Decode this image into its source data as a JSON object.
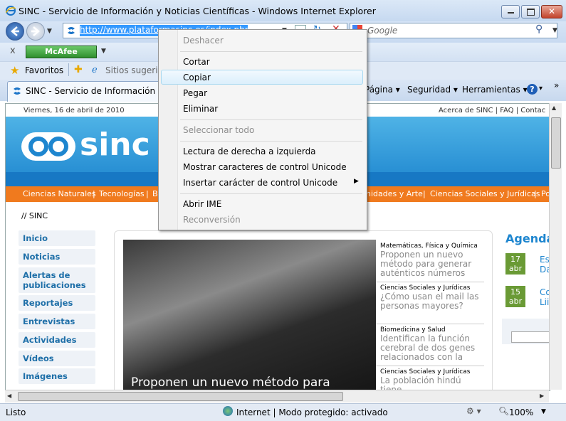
{
  "window": {
    "title": "SINC - Servicio de Información y Noticias Científicas - Windows Internet Explorer"
  },
  "address_bar": {
    "url": "http://www.plataformasinc.es/index.php/es"
  },
  "search": {
    "placeholder": "Google"
  },
  "toolbar": {
    "close_x": "x",
    "mcafee": "McAfee"
  },
  "favorites_bar": {
    "favorites_label": "Favoritos",
    "suggested_sites": "Sitios sugerido"
  },
  "tab": {
    "label": "SINC - Servicio de Información y No"
  },
  "command_bar": {
    "page": "Página",
    "security": "Seguridad",
    "tools": "Herramientas",
    "help": "?"
  },
  "page": {
    "date": "Viernes, 16 de abril de 2010",
    "top_links": [
      "Acerca de SINC",
      "FAQ",
      "Contac"
    ],
    "logo_text": "sinc",
    "menu": [
      "Ciencias Naturales",
      "Tecnologías",
      "B",
      "nidades y Arte",
      "Ciencias Sociales y Jurídicas",
      "Po"
    ],
    "breadcrumb": "// SINC",
    "sidebar": [
      "Inicio",
      "Noticias",
      "Alertas de publicaciones",
      "Reportajes",
      "Entrevistas",
      "Actividades",
      "Vídeos",
      "Imágenes"
    ],
    "feature_caption": "Proponen un nuevo método para",
    "news": [
      {
        "category": "Matemáticas, Física y Química",
        "title": "Proponen un nuevo método para generar auténticos números"
      },
      {
        "category": "Ciencias Sociales y Jurídicas",
        "title": "¿Cómo usan el mail las personas mayores?"
      },
      {
        "category": "Biomedicina y Salud",
        "title": "Identifican la función cerebral de dos genes relacionados con la"
      },
      {
        "category": "Ciencias Sociales y Jurídicas",
        "title": "La población hindú tiene"
      }
    ],
    "agenda_title": "Agenda",
    "agenda": [
      {
        "day": "17",
        "month": "abr",
        "text": "Es Da"
      },
      {
        "day": "15",
        "month": "abr",
        "text": "Co Lii"
      }
    ]
  },
  "status_bar": {
    "status": "Listo",
    "zone": "Internet | Modo protegido: activado",
    "zoom": "100%"
  },
  "context_menu": {
    "items": [
      {
        "label": "Deshacer",
        "enabled": false
      },
      {
        "label": "Cortar",
        "enabled": true
      },
      {
        "label": "Copiar",
        "enabled": true,
        "highlighted": true
      },
      {
        "label": "Pegar",
        "enabled": true
      },
      {
        "label": "Eliminar",
        "enabled": true
      },
      {
        "label": "Seleccionar todo",
        "enabled": false
      },
      {
        "label": "Lectura de derecha a izquierda",
        "enabled": true
      },
      {
        "label": "Mostrar caracteres de control Unicode",
        "enabled": true
      },
      {
        "label": "Insertar carácter de control Unicode",
        "enabled": true,
        "submenu": true
      },
      {
        "label": "Abrir IME",
        "enabled": true
      },
      {
        "label": "Reconversión",
        "enabled": false
      }
    ]
  },
  "colors": {
    "accent_orange": "#f07a1e",
    "banner_blue": "#1e86cf",
    "agenda_green": "#6a9a35",
    "link_blue": "#1e6fa8"
  }
}
